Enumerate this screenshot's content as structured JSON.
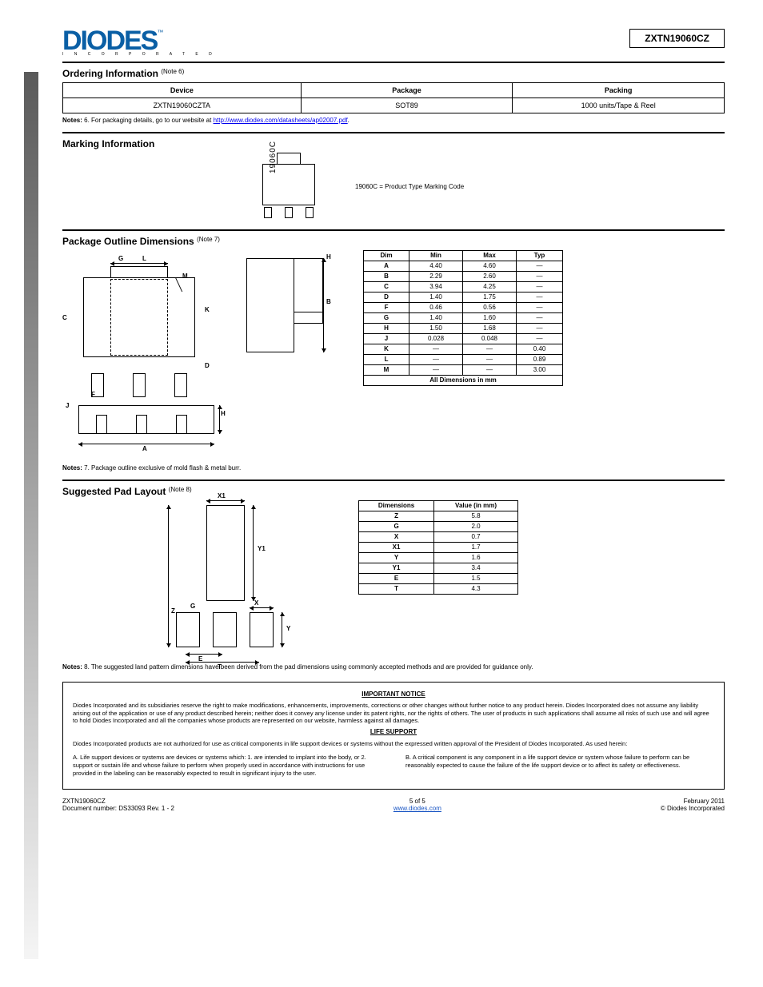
{
  "header": {
    "part_number": "ZXTN19060CZ"
  },
  "logo": {
    "main": "DIODES",
    "sub": "I N C O R P O R A T E D",
    "tm": "™"
  },
  "ordering": {
    "title": "Ordering Information",
    "legal": "(Note 6)",
    "cols": [
      "Device",
      "Package",
      "Packing"
    ],
    "rows": [
      [
        "ZXTN19060CZTA",
        "SOT89",
        "1000 units/Tape & Reel"
      ]
    ],
    "notes_label": "Notes:",
    "note_6": "6. For packaging details, go to our website at",
    "note_6_url": "http://www.diodes.com/datasheets/ap02007.pdf",
    "note_6_period": "."
  },
  "marking": {
    "title": "Marking Information",
    "code": "19060C",
    "legend": [
      "19060C = Product Type Marking Code"
    ]
  },
  "package": {
    "title": "Package Outline Dimensions",
    "legal": "(Note 7)",
    "note_7": "7. Package outline exclusive of mold flash & metal burr.",
    "dims_header": [
      "Dim",
      "Min",
      "Max",
      "Typ"
    ],
    "dims": [
      {
        "dim": "A",
        "min": "4.40",
        "max": "4.60",
        "typ": "—"
      },
      {
        "dim": "B",
        "min": "2.29",
        "max": "2.60",
        "typ": "—"
      },
      {
        "dim": "C",
        "min": "3.94",
        "max": "4.25",
        "typ": "—"
      },
      {
        "dim": "D",
        "min": "1.40",
        "max": "1.75",
        "typ": "—"
      },
      {
        "dim": "F",
        "min": "0.46",
        "max": "0.56",
        "typ": "—"
      },
      {
        "dim": "G",
        "min": "1.40",
        "max": "1.60",
        "typ": "—"
      },
      {
        "dim": "H",
        "min": "1.50",
        "max": "1.68",
        "typ": "—"
      },
      {
        "dim": "J",
        "min": "0.028",
        "max": "0.048",
        "typ": "—"
      },
      {
        "dim": "K",
        "min": "—",
        "max": "—",
        "typ": "0.40"
      },
      {
        "dim": "L",
        "min": "—",
        "max": "—",
        "typ": "0.89"
      },
      {
        "dim": "M",
        "min": "—",
        "max": "—",
        "typ": "3.00"
      }
    ],
    "dims_footer": "All Dimensions in mm",
    "drawing_labels": {
      "G": "G",
      "L": "L",
      "M": "M",
      "C": "C",
      "K": "K",
      "D": "D",
      "H": "H",
      "B": "B",
      "F": "F",
      "A": "A",
      "J": "J"
    }
  },
  "pad": {
    "title": "Suggested Pad Layout",
    "legal": "(Note 8)",
    "note_8": "8. The suggested land pattern dimensions have been derived from the pad dimensions using commonly accepted methods and are provided for guidance only.",
    "cols": [
      "Dimensions",
      "Value (in mm)"
    ],
    "rows": [
      [
        "Z",
        "5.8"
      ],
      [
        "G",
        "2.0"
      ],
      [
        "X",
        "0.7"
      ],
      [
        "X1",
        "1.7"
      ],
      [
        "Y",
        "1.6"
      ],
      [
        "Y1",
        "3.4"
      ],
      [
        "E",
        "1.5"
      ],
      [
        "T",
        "4.3"
      ]
    ],
    "labels": {
      "X1": "X1",
      "Y1": "Y1",
      "G": "G",
      "X": "X",
      "Y": "Y",
      "E": "E",
      "T": "T",
      "Z": "Z"
    }
  },
  "notice": {
    "title": "IMPORTANT NOTICE",
    "p1": "Diodes Incorporated and its subsidiaries reserve the right to make modifications, enhancements, improvements, corrections or other changes without further notice to any product herein. Diodes Incorporated does not assume any liability arising out of the application or use of any product described herein; neither does it convey any license under its patent rights, nor the rights of others. The user of products in such applications shall assume all risks of such use and will agree to hold Diodes Incorporated and all the companies whose products are represented on our website, harmless against all damages.",
    "life_title": "LIFE SUPPORT",
    "life_intro": "Diodes Incorporated products are not authorized for use as critical components in life support devices or systems without the expressed written approval of the President of Diodes Incorporated. As used herein:",
    "life_a": "A. Life support devices or systems are devices or systems which: 1. are intended to implant into the body, or 2. support or sustain life and whose failure to perform when properly used in accordance with instructions for use provided in the labeling can be reasonably expected to result in significant injury to the user.",
    "life_b": "B. A critical component is any component in a life support device or system whose failure to perform can be reasonably expected to cause the failure of the life support device or to affect its safety or effectiveness."
  },
  "footer": {
    "left_1": "ZXTN19060CZ",
    "left_2": "Document number: DS33093 Rev. 1 - 2",
    "mid_1": "5 of 5",
    "mid_2": "www.diodes.com",
    "right_1": "February 2011",
    "right_2": "© Diodes Incorporated"
  }
}
